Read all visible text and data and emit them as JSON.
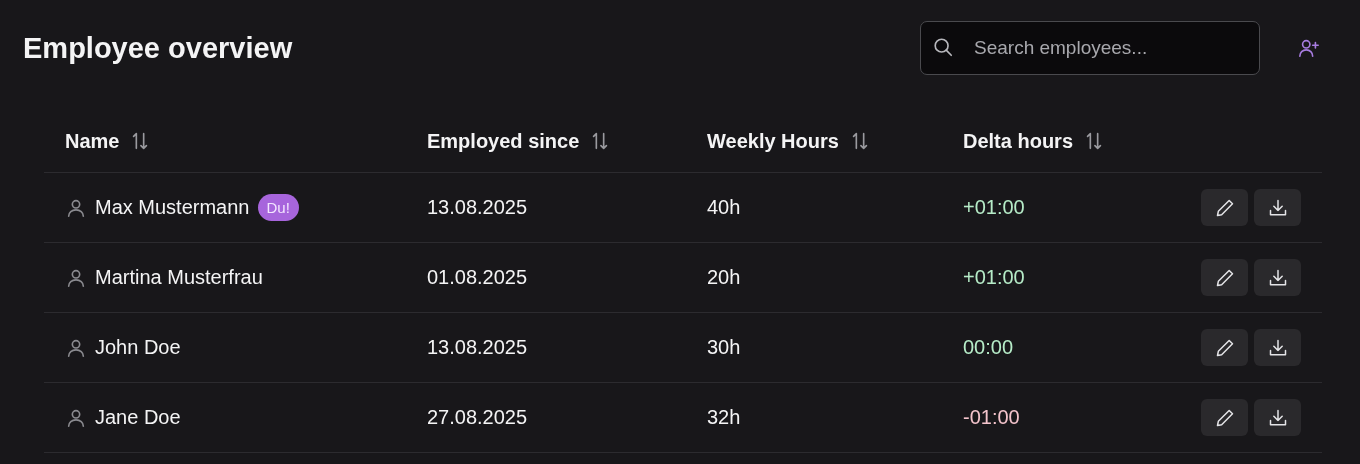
{
  "page": {
    "title": "Employee overview"
  },
  "search": {
    "placeholder": "Search employees..."
  },
  "table": {
    "columns": [
      "Name",
      "Employed since",
      "Weekly Hours",
      "Delta hours"
    ],
    "rows": [
      {
        "name": "Max Mustermann",
        "badge": "Du!",
        "employed_since": "13.08.2025",
        "weekly_hours": "40h",
        "delta": "+01:00",
        "color": "#b6ecc8"
      },
      {
        "name": "Martina Musterfrau",
        "employed_since": "01.08.2025",
        "weekly_hours": "20h",
        "delta": "+01:00",
        "color": "#b6ecc8"
      },
      {
        "name": "John Doe",
        "employed_since": "13.08.2025",
        "weekly_hours": "30h",
        "delta": "00:00",
        "color": "#b6ecc8"
      },
      {
        "name": "Jane Doe",
        "employed_since": "27.08.2025",
        "weekly_hours": "32h",
        "delta": "-01:00",
        "color": "#f4c4cc"
      }
    ]
  }
}
